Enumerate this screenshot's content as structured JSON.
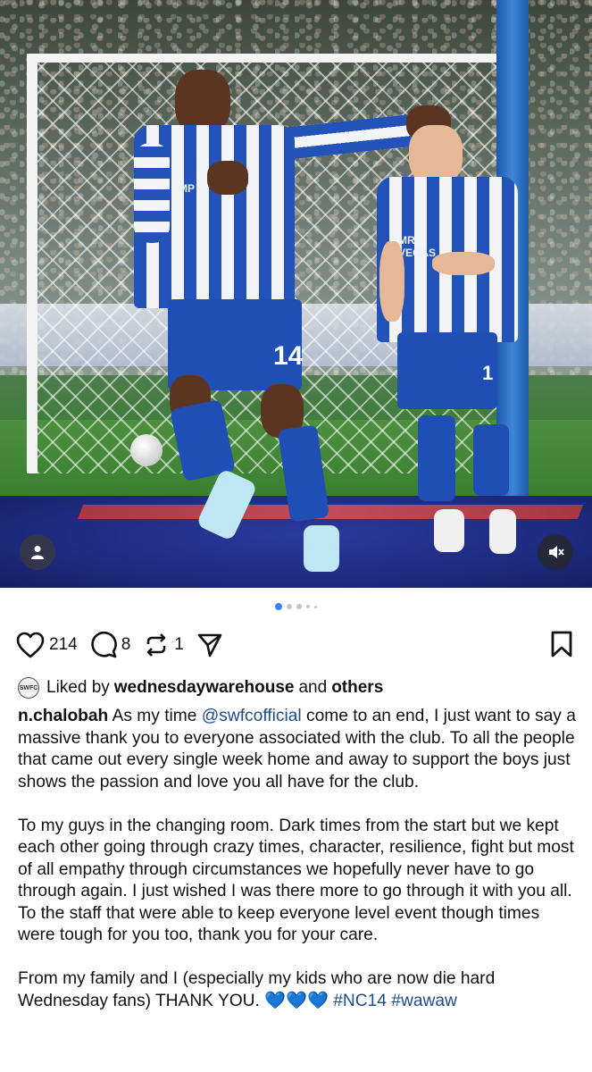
{
  "post": {
    "slide_count": 5,
    "active_slide": 1,
    "likes": "214",
    "comments": "8",
    "reposts": "1",
    "liked_by_prefix": "Liked by",
    "liked_by_user": "wednesdaywarehouse",
    "liked_by_suffix": "and",
    "liked_by_others": "others",
    "liked_avatar_text": "SWFC",
    "username": "n.chalobah",
    "caption_p1_before": "As my time",
    "caption_mention": "@swfcofficial",
    "caption_p1_after": "come to an end, I just want to say a massive thank you to everyone associated with the club. To all the people that came out every single week home and away to support the boys just shows the passion and love you all have for the club.",
    "caption_p2": "To my guys in the changing room. Dark times from the start but we kept each other going through crazy times, character, resilience, fight but most of all empathy through circumstances we hopefully never have to go through again. I just wished I was there more to go through it with you all. To the staff that were able to keep everyone level event though times were tough for you too, thank you for your care.",
    "caption_p3": "From my family and I (especially my kids who are now die hard Wednesday fans) THANK YOU.",
    "caption_emoji": "💙💙💙",
    "hashtags": "#NC14 #wawaw"
  },
  "photo": {
    "player_number_main": "14",
    "player_number_second": "1",
    "sponsor_main": "MP",
    "sponsor_second": "MR VEGAS"
  },
  "icons": {
    "heart": "heart-outline-icon",
    "comment": "comment-bubble-icon",
    "repost": "repost-arrows-icon",
    "share": "send-plane-icon",
    "bookmark": "bookmark-icon",
    "tagged_user": "person-tag-icon",
    "mute": "muted-speaker-icon"
  },
  "colors": {
    "link": "#1d4a8c",
    "active_dot": "#3b82f6",
    "kit_blue": "#2352b8"
  }
}
